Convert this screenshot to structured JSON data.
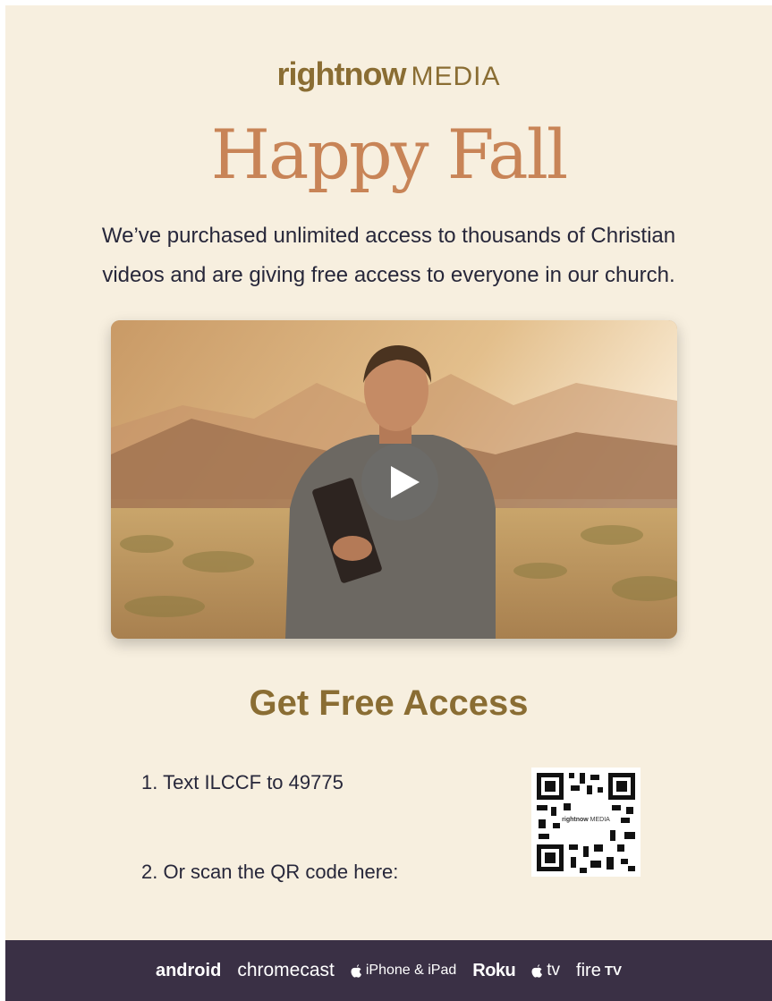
{
  "brand": {
    "logo_main": "rightnow",
    "logo_sub": "MEDIA"
  },
  "hero": {
    "title": "Happy Fall"
  },
  "intro": {
    "line1": "We’ve purchased unlimited access to thousands of Christian",
    "line2": "videos and are giving free access to everyone in our church."
  },
  "video": {
    "play_icon": "play-icon"
  },
  "access": {
    "title": "Get Free Access",
    "step1": "1. Text ILCCF to 49775",
    "step2": "2. Or scan the QR code here:",
    "qr_logo_main": "rightnow",
    "qr_logo_sub": "MEDIA"
  },
  "footer": {
    "platforms": [
      "android",
      "chromecast",
      "iPhone & iPad",
      "Roku",
      "tv",
      "fire",
      "TV"
    ]
  },
  "colors": {
    "background": "#f7efdf",
    "brand_gold": "#8a6d33",
    "title_orange": "#c88457",
    "footer_bg": "#3a3045",
    "body_text": "#27273a"
  }
}
